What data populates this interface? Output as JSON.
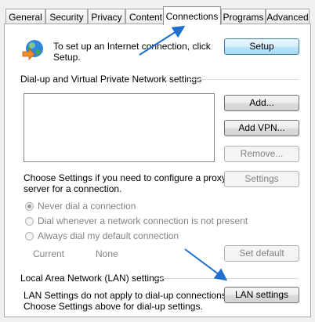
{
  "tabs": [
    "General",
    "Security",
    "Privacy",
    "Content",
    "Connections",
    "Programs",
    "Advanced"
  ],
  "setup": {
    "text_line1": "To set up an Internet connection, click",
    "text_line2": "Setup.",
    "button": "Setup"
  },
  "vpn_section": {
    "title": "Dial-up and Virtual Private Network settings",
    "add_button": "Add...",
    "add_vpn_button": "Add VPN...",
    "remove_button": "Remove..."
  },
  "proxy": {
    "text_line1": "Choose Settings if you need to configure a proxy",
    "text_line2": "server for a connection.",
    "settings_button": "Settings"
  },
  "dial_options": {
    "never": "Never dial a connection",
    "whenever": "Dial whenever a network connection is not present",
    "always": "Always dial my default connection",
    "selected": "never"
  },
  "current": {
    "label": "Current",
    "value": "None",
    "set_default_button": "Set default"
  },
  "lan": {
    "title": "Local Area Network (LAN) settings",
    "text_line1": "LAN Settings do not apply to dial-up connections.",
    "text_line2": "Choose Settings above for dial-up settings.",
    "button": "LAN settings"
  },
  "colors": {
    "arrow": "#1f6fcf",
    "globe": "#2e86de"
  }
}
